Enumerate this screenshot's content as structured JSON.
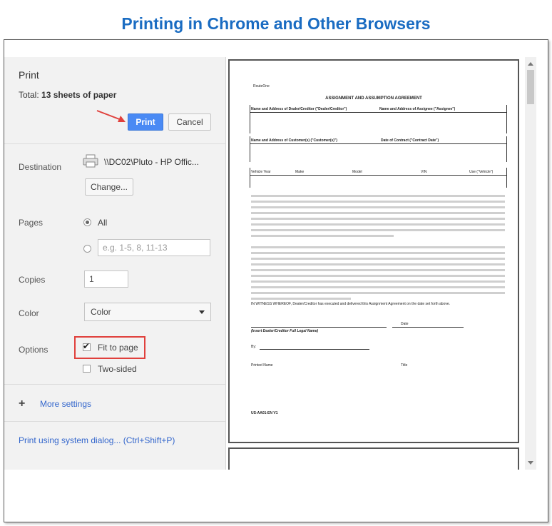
{
  "page": {
    "title": "Printing in Chrome and Other Browsers"
  },
  "sidebar": {
    "title": "Print",
    "total_label": "Total: ",
    "total_value": "13 sheets of paper",
    "print_button": "Print",
    "cancel_button": "Cancel",
    "destination": {
      "label": "Destination",
      "printer": "\\\\DC02\\Pluto - HP Offic...",
      "change_button": "Change..."
    },
    "pages": {
      "label": "Pages",
      "option_all": "All",
      "range_placeholder": "e.g. 1-5, 8, 11-13"
    },
    "copies": {
      "label": "Copies",
      "value": "1"
    },
    "color": {
      "label": "Color",
      "selected": "Color"
    },
    "options": {
      "label": "Options",
      "fit_to_page": "Fit to page",
      "two_sided": "Two-sided"
    },
    "more_settings": "More settings",
    "system_dialog": "Print using system dialog... (Ctrl+Shift+P)"
  },
  "preview": {
    "header_small": "RouteOne",
    "doc_title": "ASSIGNMENT AND ASSUMPTION AGREEMENT",
    "field1": "Name and Address of Dealer/Creditor (\"Dealer/Creditor\")",
    "field2": "Name and Address of Assignee (\"Assignee\")",
    "field3": "Name and Address of Customer(s) (\"Customer(s)\")",
    "field4": "Date of Contract (\"Contract Date\")",
    "col1": "Vehicle Year",
    "col2": "Make",
    "col3": "Model",
    "col4": "VIN",
    "col5": "Use (\"Vehicle\")",
    "witness": "IN WITNESS WHEREOF, Dealer/Creditor has executed and delivered this Assignment Agreement on the date set forth above.",
    "sign_label": "(Insert Dealer/Creditor Full Legal Name)",
    "date_label": "Date",
    "by_label": "By:",
    "printed_name": "Printed Name",
    "title_label": "Title",
    "footer_code": "US-AA01-EN V1"
  },
  "colors": {
    "title": "#1a6cc2",
    "print_button": "#4a8af4",
    "highlight": "#e0403c",
    "link": "#3366cc"
  }
}
